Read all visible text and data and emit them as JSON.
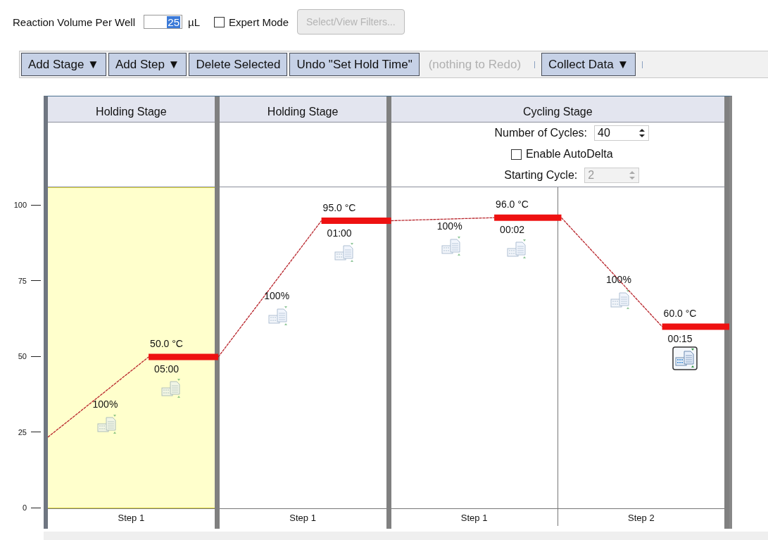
{
  "settings": {
    "volume_label": "Reaction Volume Per Well",
    "volume_value": "25",
    "volume_unit": "µL",
    "expert_mode": {
      "label": "Expert Mode",
      "checked": false
    },
    "filters_button": {
      "label": "Select/View Filters...",
      "disabled": true
    }
  },
  "toolbar": [
    {
      "label": "Add Stage ▼",
      "disabled": false,
      "separator_after": false
    },
    {
      "label": "Add Step ▼",
      "disabled": false,
      "separator_after": false
    },
    {
      "label": "Delete Selected",
      "disabled": false,
      "separator_after": false
    },
    {
      "label": "Undo \"Set Hold Time\"",
      "disabled": false,
      "separator_after": false
    },
    {
      "label": "(nothing to Redo)",
      "disabled": true,
      "separator_after": true
    },
    {
      "label": "Collect Data ▼",
      "disabled": false,
      "separator_after": true
    }
  ],
  "profile": {
    "y_ticks": [
      "100",
      "75",
      "50",
      "25",
      "0"
    ],
    "stages": [
      {
        "title": "Holding Stage",
        "kind": "holding",
        "selected": true,
        "steps": [
          {
            "label": "Step 1",
            "temperature": "50.0 °C",
            "hold_time": "05:00",
            "ramp_rate": "100%",
            "hold_collect": false,
            "ramp_collect": false
          }
        ]
      },
      {
        "title": "Holding Stage",
        "kind": "holding",
        "selected": false,
        "steps": [
          {
            "label": "Step 1",
            "temperature": "95.0 °C",
            "hold_time": "01:00",
            "ramp_rate": "100%",
            "hold_collect": false,
            "ramp_collect": false
          }
        ]
      },
      {
        "title": "Cycling Stage",
        "kind": "cycling",
        "selected": false,
        "cycles": {
          "label": "Number of Cycles:",
          "value": "40"
        },
        "auto_delta": {
          "label": "Enable AutoDelta",
          "checked": false
        },
        "starting_cycle": {
          "label": "Starting Cycle:",
          "value": "2",
          "disabled": true
        },
        "steps": [
          {
            "label": "Step 1",
            "temperature": "96.0 °C",
            "hold_time": "00:02",
            "ramp_rate": "100%",
            "hold_collect": false,
            "ramp_collect": false
          },
          {
            "label": "Step 2",
            "temperature": "60.0 °C",
            "hold_time": "00:15",
            "ramp_rate": "100%",
            "hold_collect": true,
            "ramp_collect": false
          }
        ]
      }
    ]
  }
}
